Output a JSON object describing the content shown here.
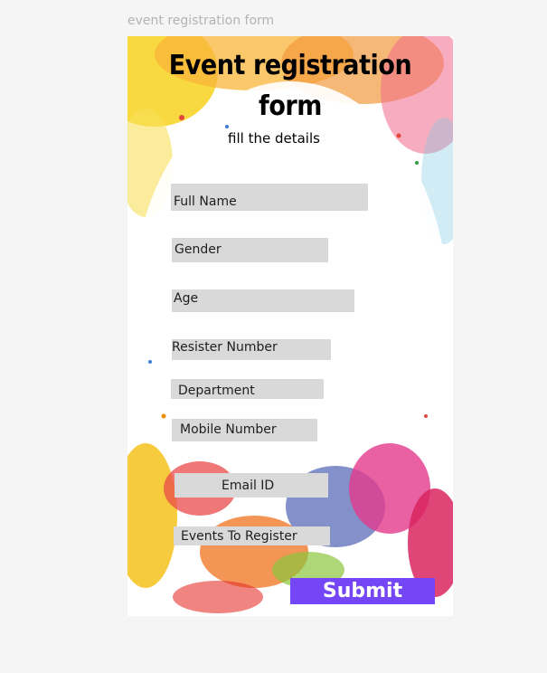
{
  "frame": {
    "label": "event registration form"
  },
  "form": {
    "title_line1": "Event registration",
    "title_line2": "form",
    "subtitle": "fill the details",
    "fields": {
      "full_name": "Full Name",
      "gender": "Gender",
      "age": "Age",
      "register_number": "Resister Number",
      "department": "Department",
      "mobile_number": "Mobile Number",
      "email_id": "Email ID",
      "events_to_register": "Events To Register"
    },
    "submit_label": "Submit"
  },
  "colors": {
    "field_bg": "#d9d9d9",
    "submit_bg": "#7446f5",
    "canvas_bg": "#f5f5f5"
  }
}
